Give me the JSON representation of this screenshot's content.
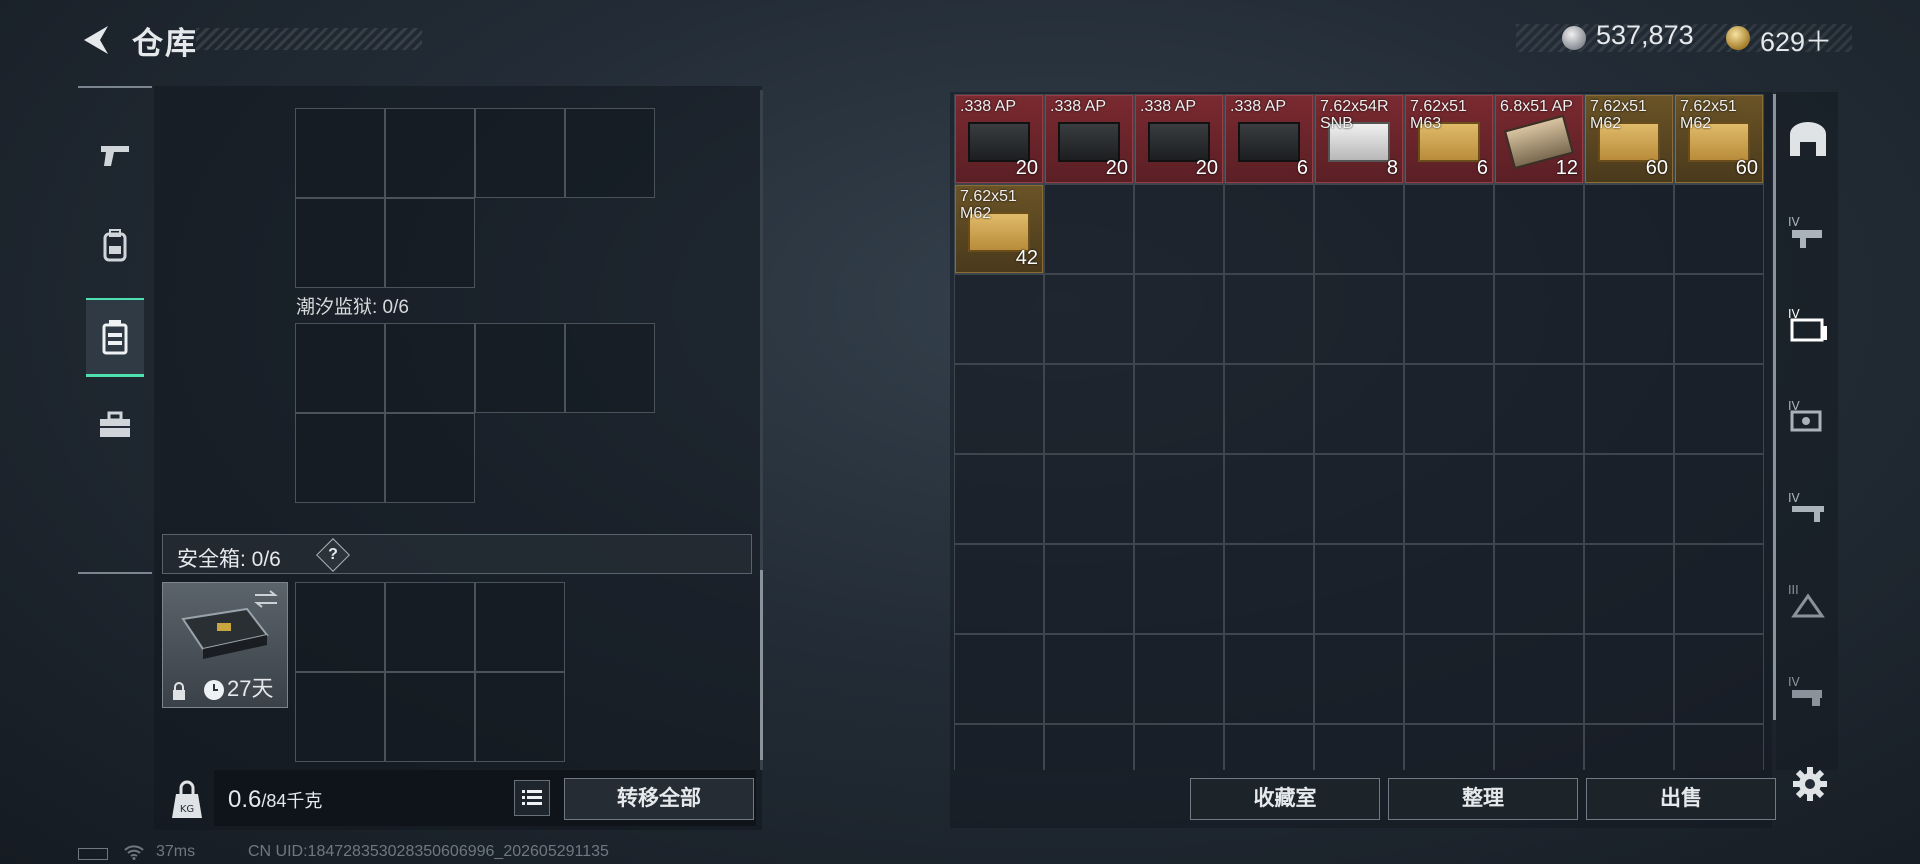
{
  "header": {
    "title": "仓库",
    "silver_amount": "537,873",
    "gold_amount": "629＋"
  },
  "left_panel": {
    "section_tidal_prison": "潮汐监狱: 0/6",
    "safebox_label": "安全箱: 0/6",
    "safebox_help": "?",
    "safebox_days": "27天",
    "weight_current": "0.6",
    "weight_max": "/84千克",
    "transfer_all_label": "转移全部"
  },
  "storage": {
    "items": [
      {
        "name": ".338 AP",
        "count": "20",
        "style": "red",
        "box": "black"
      },
      {
        "name": ".338 AP",
        "count": "20",
        "style": "red",
        "box": "black"
      },
      {
        "name": ".338 AP",
        "count": "20",
        "style": "red",
        "box": "black"
      },
      {
        "name": ".338 AP",
        "count": "6",
        "style": "red",
        "box": "black"
      },
      {
        "name": "7.62x54R SNB",
        "count": "8",
        "style": "red",
        "box": "white"
      },
      {
        "name": "7.62x51 M63",
        "count": "6",
        "style": "red",
        "box": "tan"
      },
      {
        "name": "6.8x51 AP",
        "count": "12",
        "style": "red",
        "box": "cart"
      },
      {
        "name": "7.62x51 M62",
        "count": "60",
        "style": "gold",
        "box": "tan"
      },
      {
        "name": "7.62x51 M62",
        "count": "60",
        "style": "gold",
        "box": "tan"
      },
      {
        "name": "7.62x51 M62",
        "count": "42",
        "style": "gold",
        "box": "tan"
      }
    ]
  },
  "bottom_buttons": {
    "collection_label": "收藏室",
    "organize_label": "整理",
    "sell_label": "出售"
  },
  "status": {
    "ping": "37ms",
    "uid": "CN UID:184728353028350606996_202605291135"
  },
  "colors": {
    "accent": "#4fe0b0",
    "rare_red": "#7a2a30",
    "rare_gold": "#6a5326"
  }
}
